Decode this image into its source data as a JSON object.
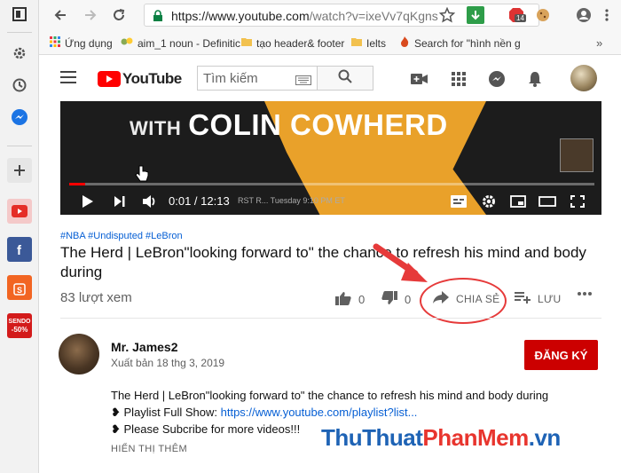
{
  "browser": {
    "url_host": "https://www.youtube.com",
    "url_path": "/watch?v=ixeVv7qKgns",
    "ext_badge": "14",
    "bookmarks": [
      {
        "label": "Ứng dụng"
      },
      {
        "label": "aim_1 noun - Definitic"
      },
      {
        "label": "tạo header& footer"
      },
      {
        "label": "Ielts"
      },
      {
        "label": "Search for \"hình nền g"
      }
    ]
  },
  "sidebar": {
    "sendo_label": "SENDO",
    "sendo_badge": "-50%"
  },
  "header": {
    "logo_text": "YouTube",
    "search_placeholder": "Tìm kiếm"
  },
  "video": {
    "overlay_with": "WITH",
    "overlay_name": "COLIN COWHERD",
    "time": "0:01 / 12:13",
    "caption_text": "RST R... Tuesday 9:10 PM ET",
    "progress": 0.03
  },
  "info": {
    "tags": "#NBA #Undisputed #LeBron",
    "title": "The Herd | LeBron\"looking forward to\" the chance to refresh his mind and body during",
    "views": "83 lượt xem",
    "likes": "0",
    "dislikes": "0",
    "share": "CHIA SẺ",
    "save": "LƯU"
  },
  "channel": {
    "name": "Mr. James2",
    "date": "Xuất bản 18 thg 3, 2019",
    "subscribe": "ĐĂNG KÝ",
    "desc1": "The Herd | LeBron\"looking forward to\" the chance to refresh his mind and body during",
    "desc2_prefix": "❥ Playlist Full Show: ",
    "desc2_link": "https://www.youtube.com/playlist?list...",
    "desc3": "❥ Please Subcribe for more videos!!!",
    "show_more": "HIỂN THỊ THÊM"
  },
  "watermark": {
    "part1": "ThuThuat",
    "part2": "PhanMem",
    "part3": ".vn"
  },
  "colors": {
    "youtube_red": "#ff0000",
    "subscribe": "#cc0000",
    "link": "#065fd4",
    "annotation": "#e63a3a"
  }
}
